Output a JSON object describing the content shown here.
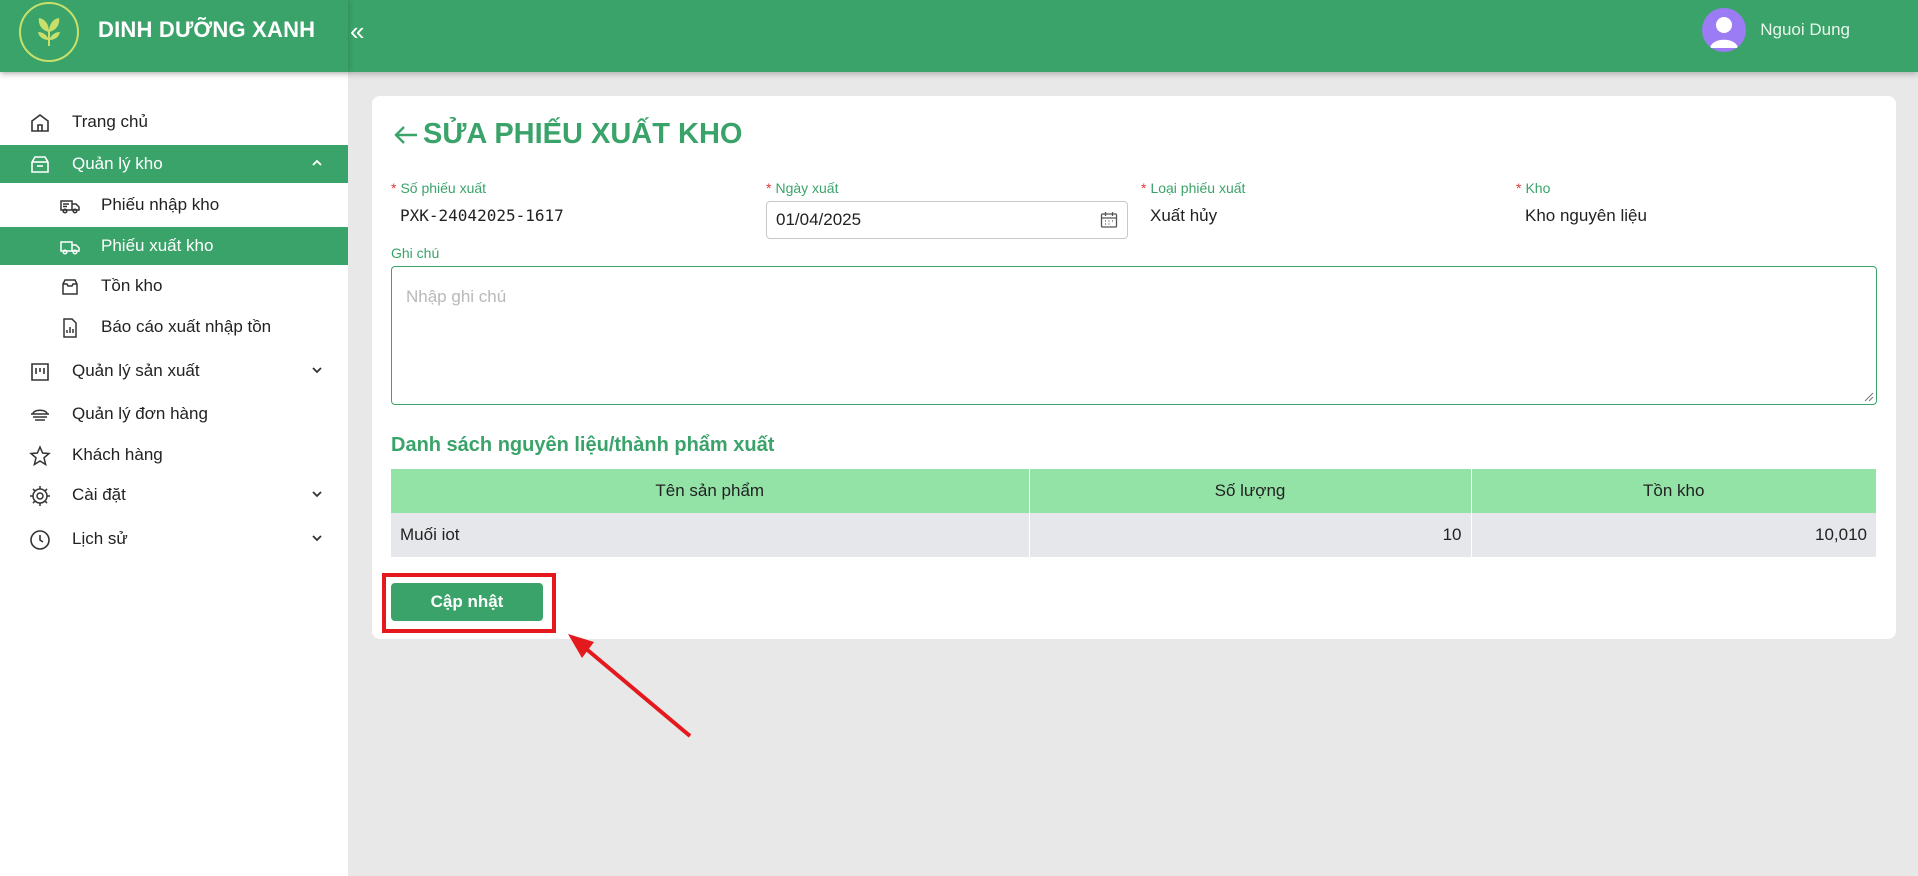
{
  "header": {
    "brand_name": "DINH DƯỠNG XANH",
    "collapse_icon": "«",
    "user_name": "Nguoi Dung"
  },
  "sidebar": {
    "items": [
      {
        "label": "Trang chủ",
        "icon": "home-icon"
      },
      {
        "label": "Quản lý kho",
        "icon": "warehouse-icon",
        "expanded": true,
        "active": true
      },
      {
        "label": "Phiếu nhập kho",
        "icon": "truck-in-icon"
      },
      {
        "label": "Phiếu xuất kho",
        "icon": "truck-out-icon",
        "active": true
      },
      {
        "label": "Tồn kho",
        "icon": "inbox-icon"
      },
      {
        "label": "Báo cáo xuất nhập tồn",
        "icon": "report-icon"
      },
      {
        "label": "Quản lý sản xuất",
        "icon": "factory-icon"
      },
      {
        "label": "Quản lý đơn hàng",
        "icon": "order-icon"
      },
      {
        "label": "Khách hàng",
        "icon": "star-icon"
      },
      {
        "label": "Cài đặt",
        "icon": "gear-icon"
      },
      {
        "label": "Lịch sử",
        "icon": "history-icon"
      }
    ]
  },
  "form": {
    "title": "SỬA PHIẾU XUẤT KHO",
    "required_mark": "*",
    "so_phieu_label": "Số phiếu xuất",
    "so_phieu_value": "PXK-24042025-1617",
    "ngay_xuat_label": "Ngày xuất",
    "ngay_xuat_value": "01/04/2025",
    "loai_phieu_label": "Loại phiếu xuất",
    "loai_phieu_value": "Xuất hủy",
    "kho_label": "Kho",
    "kho_value": "Kho nguyên liệu",
    "ghi_chu_label": "Ghi chú",
    "ghi_chu_placeholder": "Nhập ghi chú",
    "section_title": "Danh sách nguyên liệu/thành phẩm xuất",
    "submit_label": "Cập nhật"
  },
  "table": {
    "headers": [
      "Tên sản phẩm",
      "Số lượng",
      "Tồn kho"
    ],
    "rows": [
      [
        "Muối iot",
        "10",
        "10,010"
      ]
    ]
  },
  "colors": {
    "brand_green": "#3aa36a",
    "table_header": "#93e3a7",
    "highlight_red": "#e3191d",
    "avatar_purple": "#9b7cf4"
  }
}
